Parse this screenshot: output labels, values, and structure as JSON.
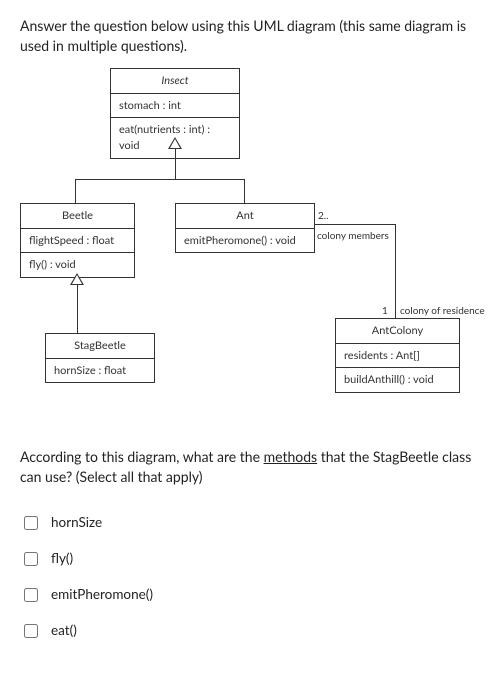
{
  "intro": "Answer the question below using this UML diagram (this same diagram is used in multiple questions).",
  "uml": {
    "insect": {
      "name": "Insect",
      "attr": "stomach : int",
      "op": "eat(nutrients : int) : void"
    },
    "beetle": {
      "name": "Beetle",
      "attr": "flightSpeed : float",
      "op": "fly() : void"
    },
    "ant": {
      "name": "Ant",
      "op": "emitPheromone() : void"
    },
    "stagbeetle": {
      "name": "StagBeetle",
      "attr": "hornSize : float"
    },
    "antcolony": {
      "name": "AntColony",
      "attr": "residents : Ant[]",
      "op": "buildAnthill() : void"
    },
    "assoc": {
      "mult_ant": "2..",
      "role_ant": "colony members",
      "mult_colony": "1",
      "role_colony": "colony of residence"
    }
  },
  "question_pre": "According to this diagram, what are the ",
  "question_underline": "methods",
  "question_post": " that the StagBeetle class can use? (Select all that apply)",
  "options": {
    "a": "hornSize",
    "b": "fly()",
    "c": "emitPheromone()",
    "d": "eat()"
  }
}
